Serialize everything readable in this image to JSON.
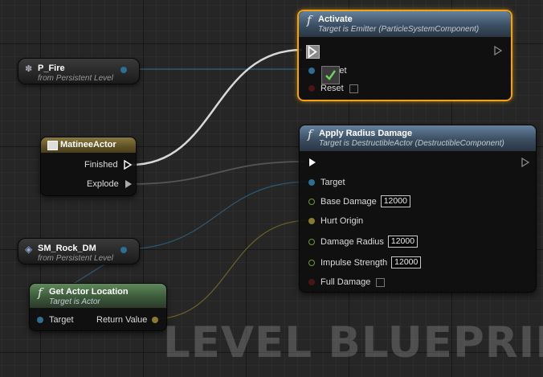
{
  "watermark": "LEVEL BLUEPRINT",
  "colors": {
    "selected_border": "#f2a313",
    "exec_wire": "#ffffff",
    "object_wire": "#2f6d94",
    "vector_wire": "#8a7b2a"
  },
  "nodes": {
    "activate": {
      "title": "Activate",
      "subtitle": "Target is Emitter (ParticleSystemComponent)",
      "pins": {
        "target": "Target",
        "reset": "Reset"
      },
      "selected": true
    },
    "apply_radius_damage": {
      "title": "Apply Radius Damage",
      "subtitle": "Target is DestructibleActor (DestructibleComponent)",
      "pins": {
        "target": "Target",
        "base_damage": "Base Damage",
        "base_damage_value": "12000",
        "hurt_origin": "Hurt Origin",
        "damage_radius": "Damage Radius",
        "damage_radius_value": "12000",
        "impulse_strength": "Impulse Strength",
        "impulse_strength_value": "12000",
        "full_damage": "Full Damage"
      }
    },
    "p_fire": {
      "title": "P_Fire",
      "subtitle": "from Persistent Level",
      "icon": "emitter-icon"
    },
    "matinee_actor": {
      "title": "MatineeActor",
      "pins": {
        "finished": "Finished",
        "explode": "Explode"
      },
      "icon": "matinee-icon"
    },
    "sm_rock": {
      "title": "SM_Rock_DM",
      "subtitle": "from Persistent Level",
      "icon": "destructible-mesh-icon"
    },
    "get_actor_location": {
      "title": "Get Actor Location",
      "subtitle": "Target is Actor",
      "pins": {
        "target": "Target",
        "return_value": "Return Value"
      }
    }
  }
}
